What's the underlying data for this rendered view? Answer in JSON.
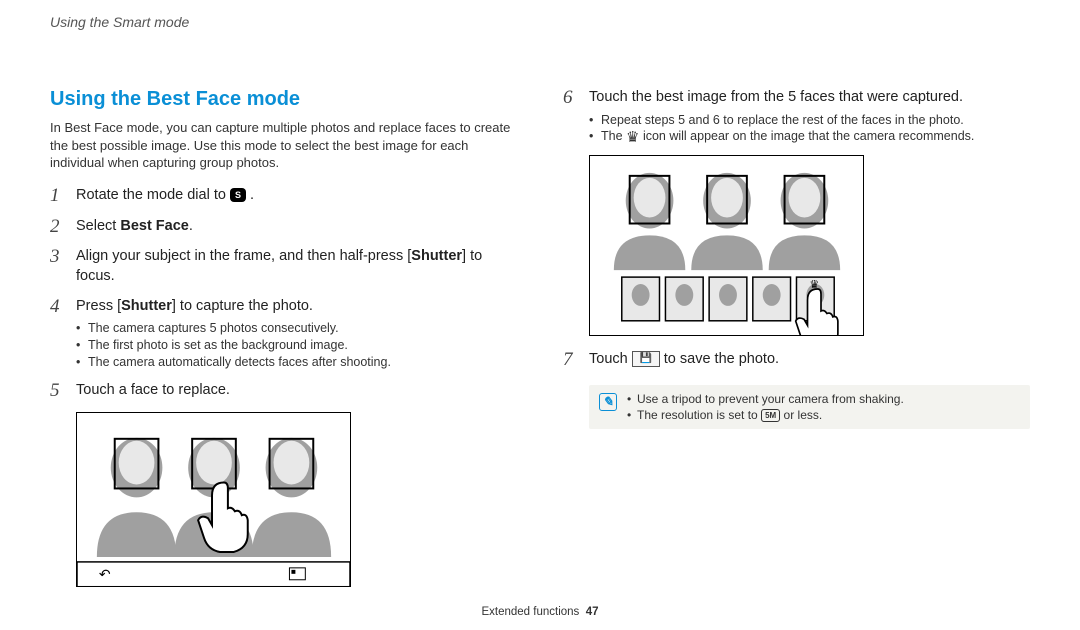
{
  "breadcrumb": "Using the Smart mode",
  "title": "Using the Best Face mode",
  "intro": "In Best Face mode, you can capture multiple photos and replace faces to create the best possible image. Use this mode to select the best image for each individual when capturing group photos.",
  "steps": {
    "s1_pre": "Rotate the mode dial to ",
    "s1_post": ".",
    "s2_pre": "Select ",
    "s2_b": "Best Face",
    "s2_post": ".",
    "s3_a": "Align your subject in the frame, and then half-press [",
    "s3_b": "Shutter",
    "s3_c": "] to focus.",
    "s4_a": "Press [",
    "s4_b": "Shutter",
    "s4_c": "] to capture the photo.",
    "s4_sub1": "The camera captures 5 photos consecutively.",
    "s4_sub2": "The first photo is set as the background image.",
    "s4_sub3": "The camera automatically detects faces after shooting.",
    "s5": "Touch a face to replace.",
    "s6": "Touch the best image from the 5 faces that were captured.",
    "s6_sub1": "Repeat steps 5 and 6 to replace the rest of the faces in the photo.",
    "s6_sub2_a": "The ",
    "s6_sub2_b": " icon will appear on the image that the camera recommends.",
    "s7_a": "Touch ",
    "s7_b": " to save the photo."
  },
  "notes": {
    "n1": "Use a tripod to prevent your camera from shaking.",
    "n2_a": "The resolution is set to ",
    "n2_b": " or less."
  },
  "icons": {
    "mode_s": "S",
    "crown": "♛",
    "save_glyph": "💾",
    "res": "5M"
  },
  "footer": {
    "section": "Extended functions",
    "page": "47"
  }
}
